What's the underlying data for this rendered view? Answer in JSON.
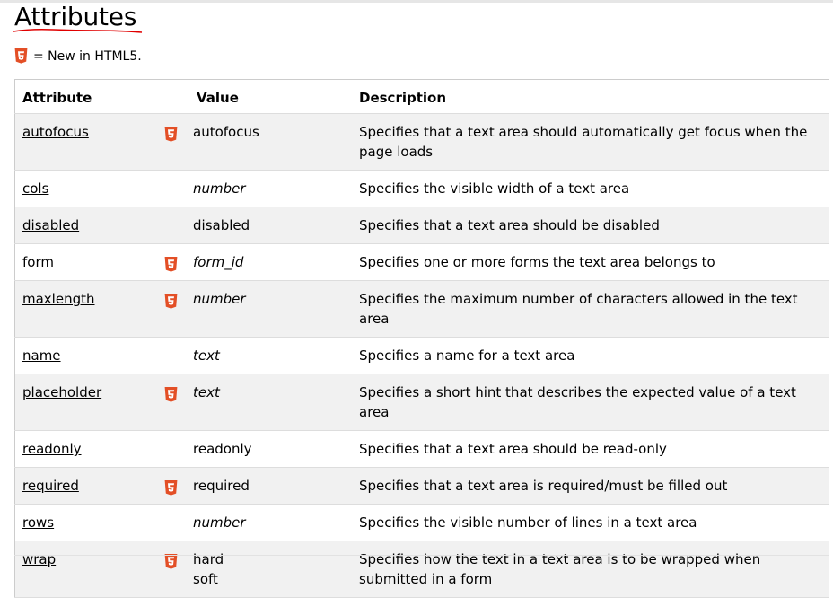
{
  "heading": {
    "title": "Attributes",
    "legend_text": "= New in HTML5."
  },
  "colors": {
    "html5_badge": "#e34f26",
    "underline": "#e00000"
  },
  "table": {
    "headers": [
      "Attribute",
      "",
      "Value",
      "Description"
    ],
    "rows": [
      {
        "attribute": "autofocus",
        "html5": true,
        "value": "autofocus",
        "value2": "",
        "italic": false,
        "description": "Specifies that a text area should automatically get focus when the page loads"
      },
      {
        "attribute": "cols",
        "html5": false,
        "value": "number",
        "value2": "",
        "italic": true,
        "description": "Specifies the visible width of a text area"
      },
      {
        "attribute": "disabled",
        "html5": false,
        "value": "disabled",
        "value2": "",
        "italic": false,
        "description": "Specifies that a text area should be disabled"
      },
      {
        "attribute": "form",
        "html5": true,
        "value": "form_id",
        "value2": "",
        "italic": true,
        "description": "Specifies one or more forms the text area belongs to"
      },
      {
        "attribute": "maxlength",
        "html5": true,
        "value": "number",
        "value2": "",
        "italic": true,
        "description": "Specifies the maximum number of characters allowed in the text area"
      },
      {
        "attribute": "name",
        "html5": false,
        "value": "text",
        "value2": "",
        "italic": true,
        "description": "Specifies a name for a text area"
      },
      {
        "attribute": "placeholder",
        "html5": true,
        "value": "text",
        "value2": "",
        "italic": true,
        "description": "Specifies a short hint that describes the expected value of a text area"
      },
      {
        "attribute": "readonly",
        "html5": false,
        "value": "readonly",
        "value2": "",
        "italic": false,
        "description": "Specifies that a text area should be read-only"
      },
      {
        "attribute": "required",
        "html5": true,
        "value": "required",
        "value2": "",
        "italic": false,
        "description": "Specifies that a text area is required/must be filled out"
      },
      {
        "attribute": "rows",
        "html5": false,
        "value": "number",
        "value2": "",
        "italic": true,
        "description": "Specifies the visible number of lines in a text area"
      },
      {
        "attribute": "wrap",
        "html5": true,
        "value": "hard",
        "value2": "soft",
        "italic": false,
        "description": "Specifies how the text in a text area is to be wrapped when submitted in a form"
      }
    ]
  }
}
